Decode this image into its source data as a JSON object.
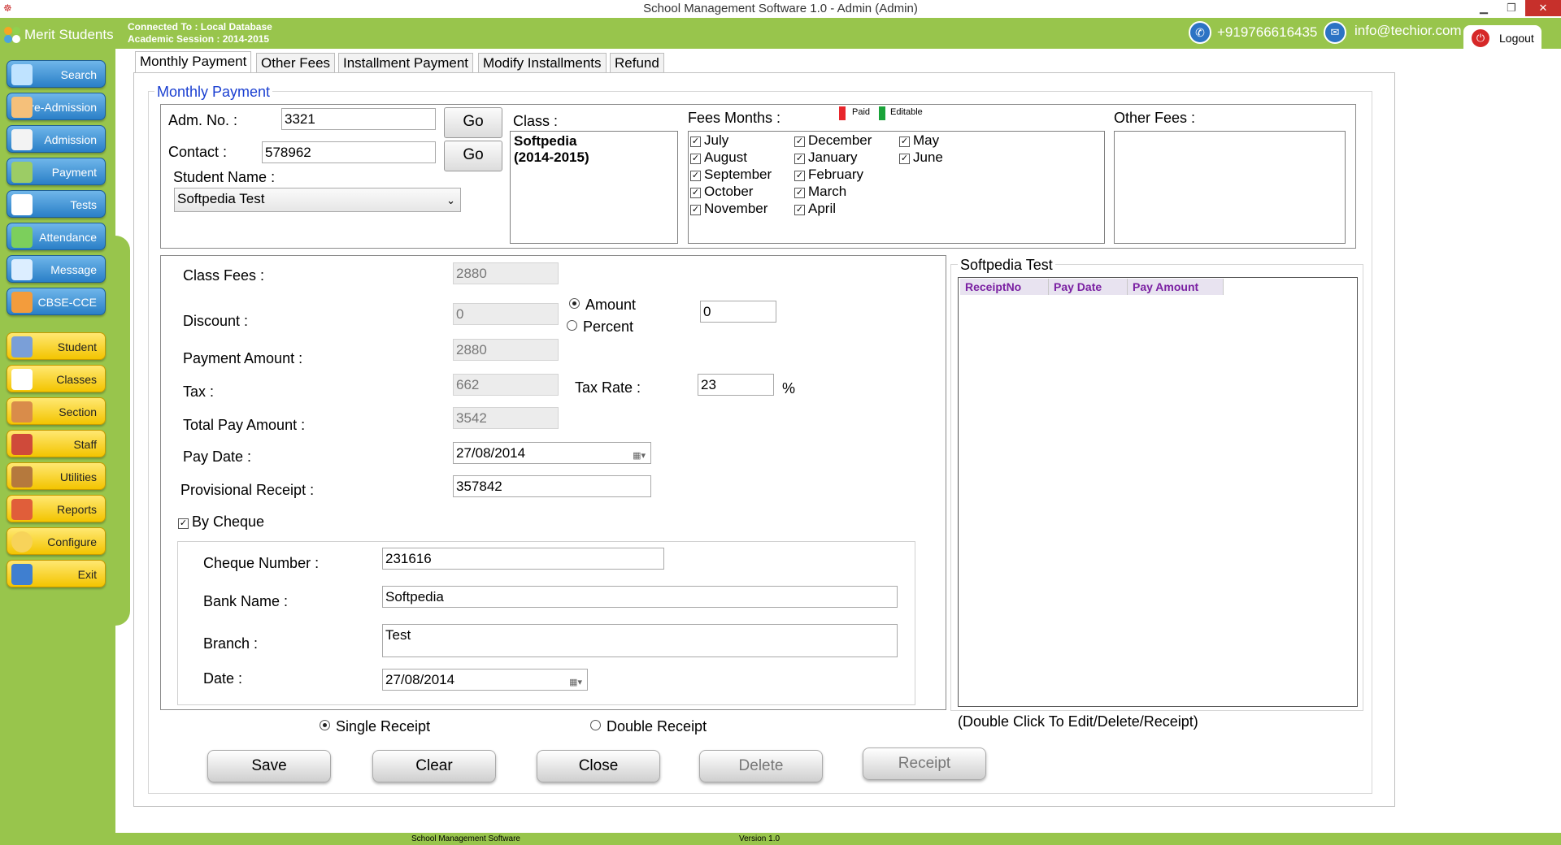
{
  "window": {
    "title": "School Management Software 1.0  -  Admin (Admin)"
  },
  "header": {
    "app_name": "Merit Students",
    "connection": "Connected To : Local Database",
    "session": "Academic Session : 2014-2015",
    "phone": "+919766616435",
    "email": "info@techior.com",
    "logout": "Logout"
  },
  "sidebar": {
    "blue_items": [
      "Search",
      "Pre-Admission",
      "Admission",
      "Payment",
      "Tests",
      "Attendance",
      "Message",
      "CBSE-CCE"
    ],
    "yellow_items": [
      "Student",
      "Classes",
      "Section",
      "Staff",
      "Utilities",
      "Reports",
      "Configure",
      "Exit"
    ]
  },
  "tabs": [
    "Monthly Payment",
    "Other Fees",
    "Installment Payment",
    "Modify Installments",
    "Refund"
  ],
  "group_title": "Monthly Payment",
  "student": {
    "adm_label": "Adm. No. :",
    "adm_value": "3321",
    "contact_label": "Contact :",
    "contact_value": "578962",
    "go": "Go",
    "name_label": "Student Name :",
    "name_value": "Softpedia  Test",
    "class_label": "Class  :",
    "class_line1": "Softpedia",
    "class_line2": "(2014-2015)",
    "fees_months_label": "Fees Months :",
    "legend_paid": "Paid",
    "legend_editable": "Editable",
    "other_fees_label": "Other Fees :",
    "months_col1": [
      "July",
      "August",
      "September",
      "October",
      "November"
    ],
    "months_col2": [
      "December",
      "January",
      "February",
      "March",
      "April"
    ],
    "months_col3": [
      "May",
      "June"
    ]
  },
  "payment": {
    "class_fees_label": "Class Fees  :",
    "class_fees": "2880",
    "discount_label": "Discount :",
    "discount": "0",
    "amount_opt": "Amount",
    "percent_opt": "Percent",
    "discount_input": "0",
    "payment_amount_label": "Payment Amount :",
    "payment_amount": "2880",
    "tax_label": "Tax  :",
    "tax": "662",
    "tax_rate_label": "Tax Rate  :",
    "tax_rate": "23",
    "percent_sign": "%",
    "total_label": "Total Pay Amount :",
    "total": "3542",
    "pay_date_label": "Pay Date :",
    "pay_date": "27/08/2014",
    "prov_label": "Provisional Receipt :",
    "prov_value": "357842",
    "by_cheque": "By Cheque",
    "cheque_no_label": "Cheque Number :",
    "cheque_no": "231616",
    "bank_label": "Bank Name :",
    "bank": "Softpedia",
    "branch_label": "Branch :",
    "branch": "Test",
    "date_label": "Date :",
    "date": "27/08/2014"
  },
  "receipts": {
    "title": "Softpedia  Test",
    "columns": [
      "ReceiptNo",
      "Pay Date",
      "Pay Amount"
    ],
    "hint": "(Double Click To Edit/Delete/Receipt)"
  },
  "receipt_type": {
    "single": "Single Receipt",
    "double": "Double Receipt"
  },
  "actions": {
    "save": "Save",
    "clear": "Clear",
    "close": "Close",
    "delete": "Delete",
    "receipt": "Receipt"
  },
  "footer": {
    "left": "School Management Software",
    "right": "Version 1.0"
  },
  "colors": {
    "green": "#98c54c",
    "blue_nav": "#2a7fc7",
    "yellow_nav": "#f3c400",
    "paid": "#e8262c",
    "editable": "#1aa33a",
    "group_title": "#1a3fd1"
  }
}
